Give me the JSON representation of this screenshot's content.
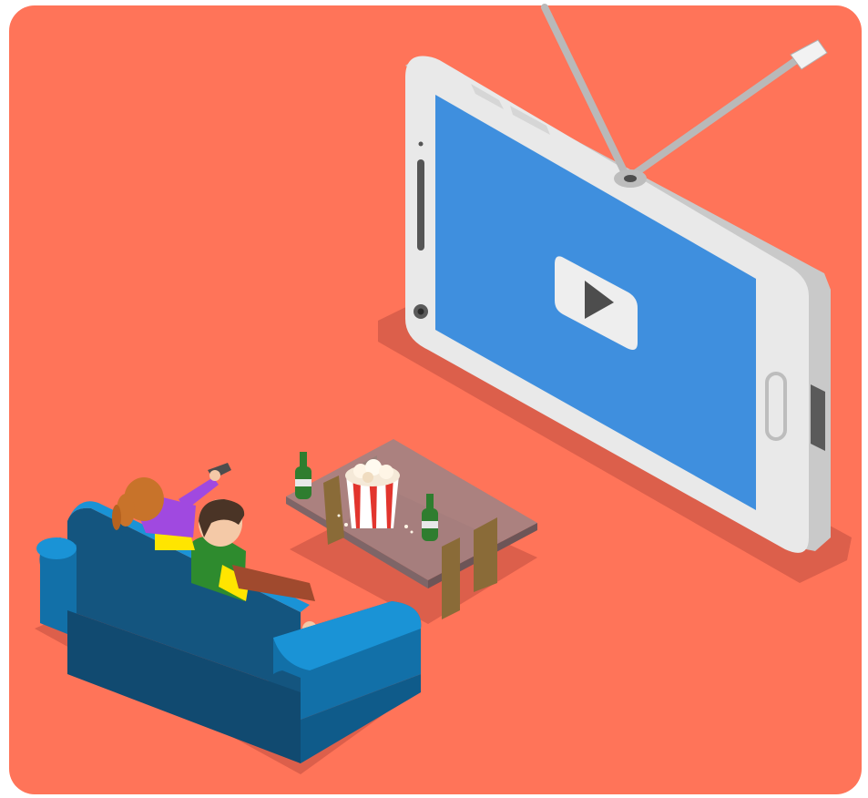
{
  "illustration": {
    "subject": "isometric-couple-watching-phone-tv",
    "colors": {
      "page_bg": "#ffffff",
      "floor": "#ff7459",
      "floor_shadow": "#dc5f4b",
      "phone_body": "#e9e9e9",
      "phone_side": "#c9c9c9",
      "screen": "#3f8fde",
      "play_card": "#eeeeee",
      "play_triangle": "#4d4d4d",
      "antenna": "#b9b9b9",
      "sofa_front": "#14557f",
      "sofa_top": "#1a93d6",
      "sofa_side": "#1270a8",
      "table_glass": "#9c8486",
      "table_leg": "#8a6b38",
      "bottle": "#2f7d2f",
      "popcorn_stripe": "#e2352e",
      "man_hair": "#4a3426",
      "man_shirt": "#2e8b2e",
      "man_sleeve": "#ffe500",
      "woman_hair": "#c8732a",
      "woman_shirt": "#a049e0",
      "skin": "#f4c9a7",
      "pants": "#a04a2e"
    },
    "icons": [
      "play-icon",
      "antenna-icon",
      "popcorn-icon",
      "bottle-icon",
      "remote-icon"
    ]
  }
}
